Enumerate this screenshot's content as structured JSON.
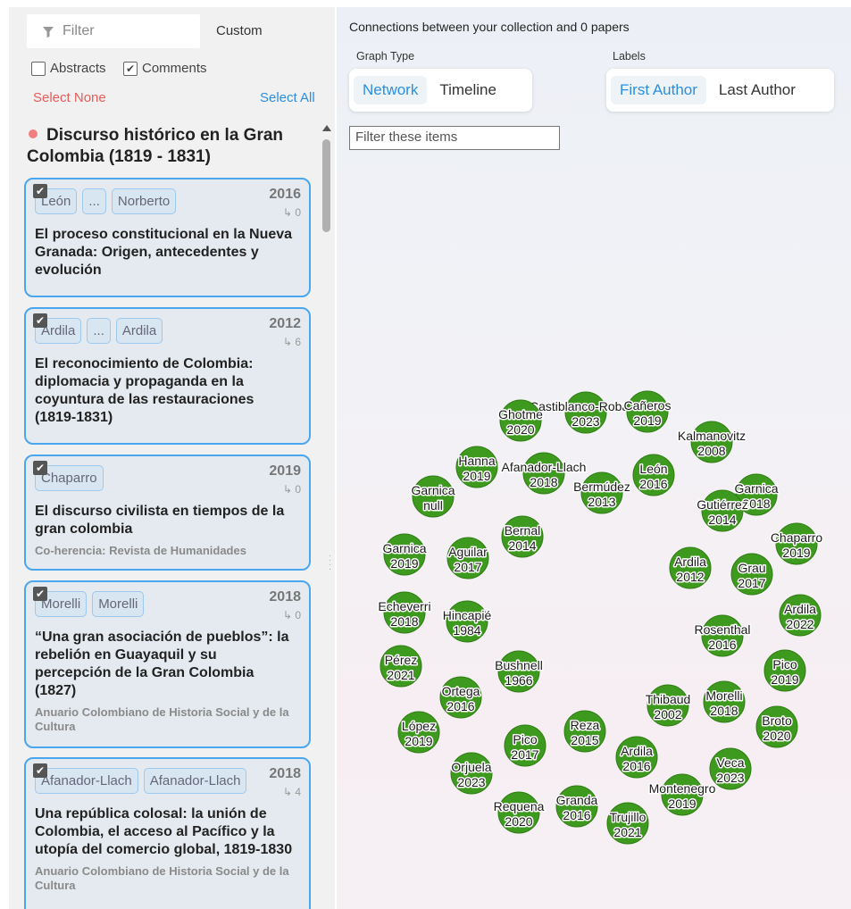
{
  "sidebar": {
    "filter_placeholder": "Filter",
    "custom_label": "Custom",
    "abstracts_label": "Abstracts",
    "comments_label": "Comments",
    "select_none": "Select None",
    "select_all": "Select All",
    "collection_title": "Discurso histórico en la Gran Colombia (1819 - 1831)",
    "cards": [
      {
        "authors": [
          "León",
          "...",
          "Norberto"
        ],
        "year": "2016",
        "cites": "↳ 0",
        "title": "El proceso constitucional en la Nueva Granada: Origen, antecedentes y evolución",
        "journal": ""
      },
      {
        "authors": [
          "Ardila",
          "...",
          "Ardila"
        ],
        "year": "2012",
        "cites": "↳ 6",
        "title": "El reconocimiento de Colombia: diplomacia y propaganda en la coyuntura de las restauraciones (1819-1831)",
        "journal": ""
      },
      {
        "authors": [
          "Chaparro"
        ],
        "year": "2019",
        "cites": "↳ 0",
        "title": "El discurso civilista en tiempos de la gran colombia",
        "journal": "Co-herencia: Revista de Humanidades"
      },
      {
        "authors": [
          "Morelli",
          "Morelli"
        ],
        "year": "2018",
        "cites": "↳ 0",
        "title": "“Una gran asociación de pueblos”: la rebelión en Guayaquil y su percepción de la Gran Colombia (1827)",
        "journal": "Anuario Colombiano de Historia Social y de la Cultura"
      },
      {
        "authors": [
          "Afanador-Llach",
          "Afanador-Llach"
        ],
        "year": "2018",
        "cites": "↳ 4",
        "title": "Una república colosal: la unión de Colombia, el acceso al Pacífico y la utopía del comercio global, 1819-1830",
        "journal": "Anuario Colombiano de Historia Social y de la Cultura"
      }
    ]
  },
  "main": {
    "heading": "Connections between your collection and 0 papers",
    "graph_type_label": "Graph Type",
    "graph_type_options": [
      "Network",
      "Timeline"
    ],
    "labels_label": "Labels",
    "labels_options": [
      "First Author",
      "Last Author"
    ],
    "filter_items_placeholder": "Filter these items"
  },
  "colors": {
    "accent": "#2b8fe0",
    "card_border": "#4aa6ee",
    "node_green": "#3e9a1e",
    "select_none": "#e85c5c",
    "collection_dot": "#f08080"
  },
  "graph_nodes": [
    {
      "name": "Castiblanco-Robayo",
      "year": "2023"
    },
    {
      "name": "Ghotme",
      "year": "2020"
    },
    {
      "name": "Cañeros",
      "year": "2019"
    },
    {
      "name": "Kalmanovitz",
      "year": "2008"
    },
    {
      "name": "Hanna",
      "year": "2019"
    },
    {
      "name": "Afanador-Llach",
      "year": "2018"
    },
    {
      "name": "León",
      "year": "2016"
    },
    {
      "name": "Garnica",
      "year": "2018"
    },
    {
      "name": "Garnica",
      "year": "null"
    },
    {
      "name": "Bermúdez",
      "year": "2013"
    },
    {
      "name": "Gutiérrez",
      "year": "2014"
    },
    {
      "name": "Bernal",
      "year": "2014"
    },
    {
      "name": "Chaparro",
      "year": "2019"
    },
    {
      "name": "Garnica",
      "year": "2019"
    },
    {
      "name": "Aguilar",
      "year": "2017"
    },
    {
      "name": "Ardila",
      "year": "2012"
    },
    {
      "name": "Grau",
      "year": "2017"
    },
    {
      "name": "Echeverri",
      "year": "2018"
    },
    {
      "name": "Hincapié",
      "year": "1984"
    },
    {
      "name": "Ardila",
      "year": "2022"
    },
    {
      "name": "Rosenthal",
      "year": "2016"
    },
    {
      "name": "Pérez",
      "year": "2021"
    },
    {
      "name": "Pico",
      "year": "2019"
    },
    {
      "name": "Bushnell",
      "year": "1966"
    },
    {
      "name": "Ortega",
      "year": "2016"
    },
    {
      "name": "Thibaud",
      "year": "2002"
    },
    {
      "name": "Morelli",
      "year": "2018"
    },
    {
      "name": "Broto",
      "year": "2020"
    },
    {
      "name": "López",
      "year": "2019"
    },
    {
      "name": "Reza",
      "year": "2015"
    },
    {
      "name": "Pico",
      "year": "2017"
    },
    {
      "name": "Ardila",
      "year": "2016"
    },
    {
      "name": "Veca",
      "year": "2023"
    },
    {
      "name": "Orjuela",
      "year": "2023"
    },
    {
      "name": "Montenegro",
      "year": "2019"
    },
    {
      "name": "Requena",
      "year": "2020"
    },
    {
      "name": "Granda",
      "year": "2016"
    },
    {
      "name": "Trujillo",
      "year": "2021"
    }
  ]
}
